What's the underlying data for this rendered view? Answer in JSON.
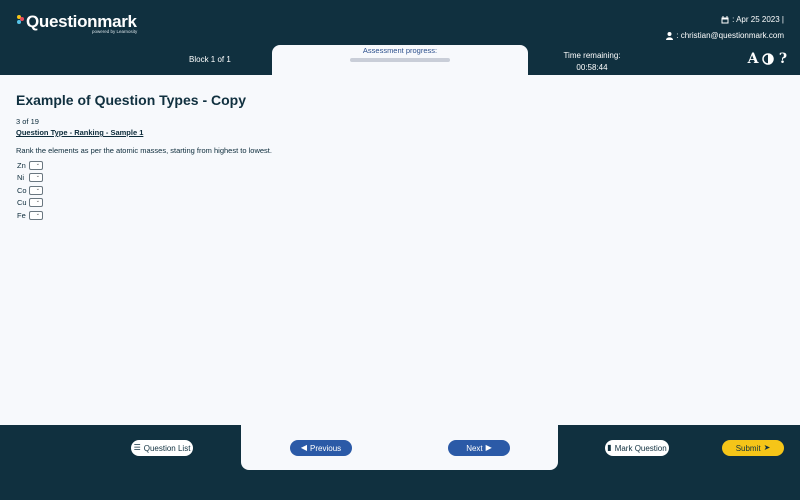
{
  "header": {
    "logo_text": "Questionmark",
    "logo_sub": "powered by Learnosity",
    "date": ": Apr 25 2023 |",
    "user": ": christian@questionmark.com",
    "block": "Block 1 of 1",
    "progress_label": "Assessment progress:",
    "progress_value": 0.0,
    "time_label": "Time remaining:",
    "time_value": "00:58:44",
    "tools": {
      "font_size": "A",
      "contrast": "◐",
      "help": "?"
    }
  },
  "main": {
    "title": "Example of Question Types - Copy",
    "counter": "3  of 19",
    "question_type": "Question Type - Ranking - Sample 1",
    "stem": "Rank the elements as per the atomic masses, starting from highest to lowest.",
    "items": [
      {
        "label": "Zn"
      },
      {
        "label": "Ni"
      },
      {
        "label": "Co"
      },
      {
        "label": "Cu"
      },
      {
        "label": "Fe"
      }
    ]
  },
  "footer": {
    "question_list": "Question List",
    "previous": "Previous",
    "next": "Next",
    "mark": "Mark Question",
    "submit": "Submit"
  },
  "colors": {
    "header_bg": "#10303f",
    "accent_blue": "#2b5aa7",
    "submit_yellow": "#f5c518"
  }
}
